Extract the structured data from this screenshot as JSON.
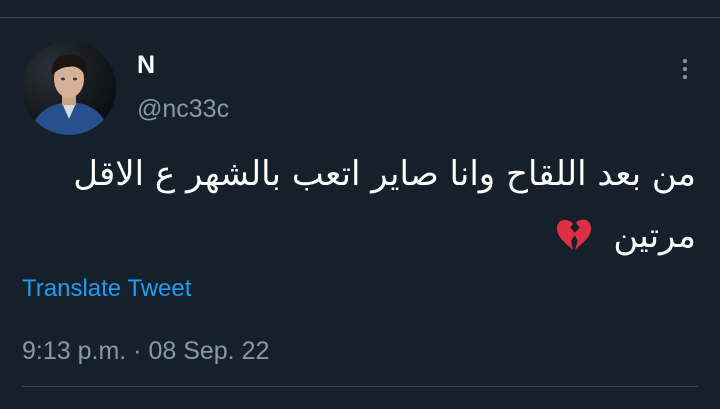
{
  "tweet": {
    "author": {
      "display_name": "N",
      "handle": "@nc33c",
      "avatar_icon": "profile-photo"
    },
    "text": {
      "line1": "من بعد اللقاح وانا صاير اتعب بالشهر ع الاقل",
      "line2": "مرتين",
      "emoji": "broken-heart-icon"
    },
    "translate_label": "Translate Tweet",
    "timestamp": "9:13 p.m. · 08 Sep. 22",
    "menu_icon": "more-vertical-icon"
  },
  "colors": {
    "background": "#15202b",
    "primary_text": "#ffffff",
    "secondary_text": "#8899a6",
    "link": "#1d9bf0",
    "divider": "#38444d",
    "emoji_heart": "#dd2e44"
  }
}
